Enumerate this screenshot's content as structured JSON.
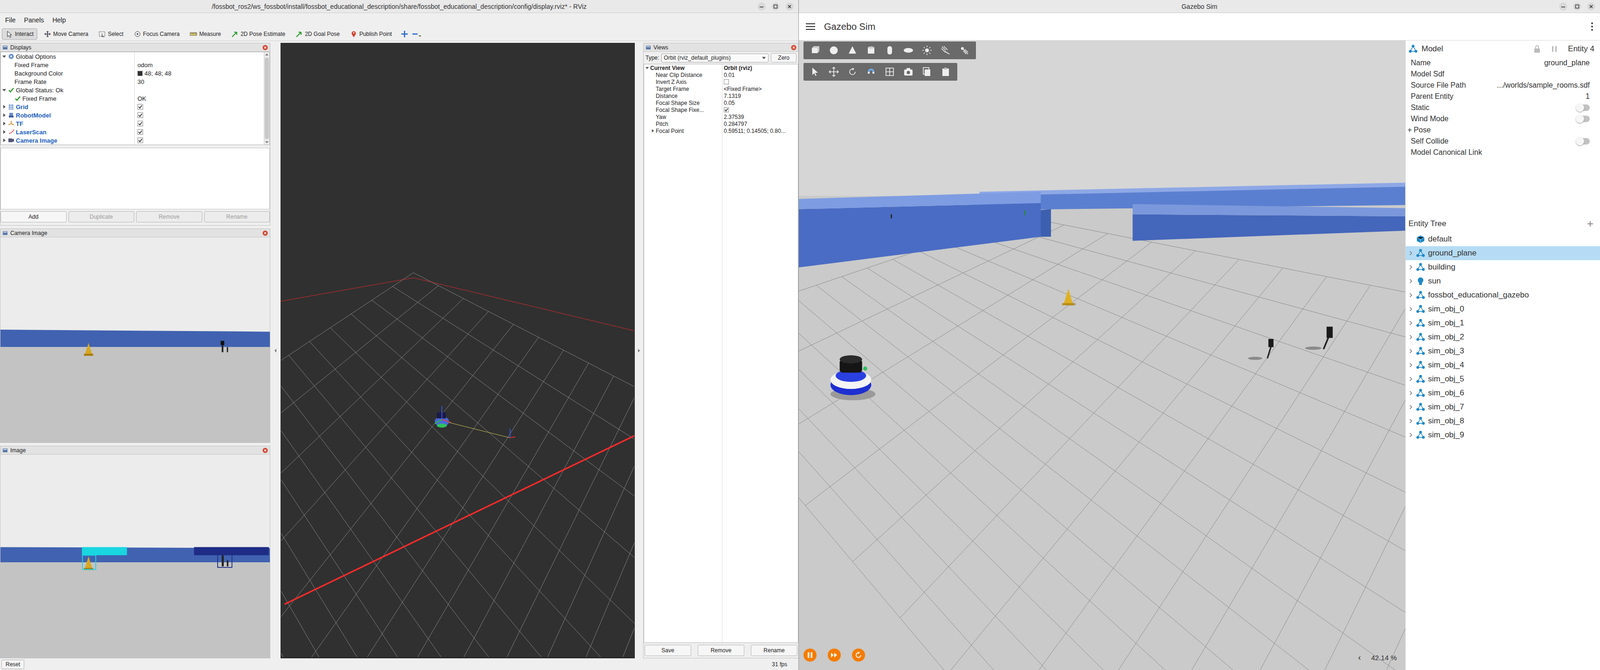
{
  "rviz": {
    "title": "/fossbot_ros2/ws_fossbot/install/fossbot_educational_description/share/fossbot_educational_description/config/display.rviz* - RViz",
    "menu": [
      "File",
      "Panels",
      "Help"
    ],
    "tools": [
      {
        "label": "Interact",
        "selected": true
      },
      {
        "label": "Move Camera",
        "selected": false
      },
      {
        "label": "Select",
        "selected": false
      },
      {
        "label": "Focus Camera",
        "selected": false
      },
      {
        "label": "Measure",
        "selected": false
      },
      {
        "label": "2D Pose Estimate",
        "selected": false
      },
      {
        "label": "2D Goal Pose",
        "selected": false
      },
      {
        "label": "Publish Point",
        "selected": false
      }
    ],
    "displays": {
      "title": "Displays",
      "rows": [
        {
          "label": "Global Options",
          "kind": "group",
          "depth": 0,
          "expanded": true
        },
        {
          "label": "Fixed Frame",
          "value": "odom",
          "kind": "property",
          "depth": 1
        },
        {
          "label": "Background Color",
          "value": "48; 48; 48",
          "kind": "color",
          "depth": 1,
          "color": "#303030"
        },
        {
          "label": "Frame Rate",
          "value": "30",
          "kind": "property",
          "depth": 1
        },
        {
          "label": "Global Status: Ok",
          "kind": "status",
          "depth": 0,
          "expanded": true
        },
        {
          "label": "Fixed Frame",
          "value": "OK",
          "kind": "status",
          "depth": 1
        },
        {
          "label": "Grid",
          "kind": "display",
          "depth": 0,
          "expanded": false,
          "checked": true
        },
        {
          "label": "RobotModel",
          "kind": "display",
          "depth": 0,
          "expanded": false,
          "checked": true
        },
        {
          "label": "TF",
          "kind": "display",
          "depth": 0,
          "expanded": false,
          "checked": true
        },
        {
          "label": "LaserScan",
          "kind": "display",
          "depth": 0,
          "expanded": false,
          "checked": true
        },
        {
          "label": "Camera Image",
          "kind": "display",
          "depth": 0,
          "expanded": false,
          "checked": true
        }
      ],
      "buttons": [
        {
          "label": "Add",
          "disabled": false
        },
        {
          "label": "Duplicate",
          "disabled": true
        },
        {
          "label": "Remove",
          "disabled": true
        },
        {
          "label": "Rename",
          "disabled": true
        }
      ]
    },
    "camera_panel": {
      "title": "Camera Image"
    },
    "image_panel": {
      "title": "Image"
    },
    "views": {
      "title": "Views",
      "type_label": "Type:",
      "type_value": "Orbit (rviz_default_plugins)",
      "zero": "Zero",
      "rows": [
        {
          "label": "Current View",
          "value": "Orbit (rviz)",
          "kind": "group",
          "depth": 0,
          "expanded": true
        },
        {
          "label": "Near Clip Distance",
          "value": "0.01",
          "kind": "text",
          "depth": 1
        },
        {
          "label": "Invert Z Axis",
          "kind": "check",
          "depth": 1,
          "checked": false
        },
        {
          "label": "Target Frame",
          "value": "<Fixed Frame>",
          "kind": "text",
          "depth": 1
        },
        {
          "label": "Distance",
          "value": "7.1319",
          "kind": "text",
          "depth": 1
        },
        {
          "label": "Focal Shape Size",
          "value": "0.05",
          "kind": "text",
          "depth": 1
        },
        {
          "label": "Focal Shape Fixe...",
          "kind": "check",
          "depth": 1,
          "checked": true
        },
        {
          "label": "Yaw",
          "value": "2.37539",
          "kind": "text",
          "depth": 1
        },
        {
          "label": "Pitch",
          "value": "0.284797",
          "kind": "text",
          "depth": 1
        },
        {
          "label": "Focal Point",
          "value": "0.59511; 0.14505; 0.80...",
          "kind": "group",
          "depth": 1,
          "expanded": false
        }
      ],
      "buttons": [
        "Save",
        "Remove",
        "Rename"
      ]
    },
    "status_bar": {
      "reset": "Reset",
      "fps": "31 fps"
    }
  },
  "gazebo": {
    "title": "Gazebo Sim",
    "app_title": "Gazebo Sim",
    "inspector": {
      "title": "Model",
      "entity": "Entity 4",
      "rows": [
        {
          "label": "Name",
          "value": "ground_plane",
          "kind": "text"
        },
        {
          "label": "Model Sdf",
          "kind": "label"
        },
        {
          "label": "Source File Path",
          "value": ".../worlds/sample_rooms.sdf",
          "kind": "text"
        },
        {
          "label": "Parent Entity",
          "value": "1",
          "kind": "text"
        },
        {
          "label": "Static",
          "kind": "toggle",
          "on": false
        },
        {
          "label": "Wind Mode",
          "kind": "toggle",
          "on": false
        },
        {
          "label": "Pose",
          "kind": "group",
          "expander": "+",
          "expanded": false
        },
        {
          "label": "Self Collide",
          "kind": "toggle",
          "on": false
        },
        {
          "label": "Model Canonical Link",
          "kind": "label"
        }
      ]
    },
    "entity_tree": {
      "title": "Entity Tree",
      "add": "+",
      "items": [
        {
          "label": "default",
          "kind": "world",
          "selected": false
        },
        {
          "label": "ground_plane",
          "kind": "model",
          "selected": true
        },
        {
          "label": "building",
          "kind": "model",
          "selected": false
        },
        {
          "label": "sun",
          "kind": "light",
          "selected": false
        },
        {
          "label": "fossbot_educational_gazebo",
          "kind": "model",
          "selected": false
        },
        {
          "label": "sim_obj_0",
          "kind": "model",
          "selected": false
        },
        {
          "label": "sim_obj_1",
          "kind": "model",
          "selected": false
        },
        {
          "label": "sim_obj_2",
          "kind": "model",
          "selected": false
        },
        {
          "label": "sim_obj_3",
          "kind": "model",
          "selected": false
        },
        {
          "label": "sim_obj_4",
          "kind": "model",
          "selected": false
        },
        {
          "label": "sim_obj_5",
          "kind": "model",
          "selected": false
        },
        {
          "label": "sim_obj_6",
          "kind": "model",
          "selected": false
        },
        {
          "label": "sim_obj_7",
          "kind": "model",
          "selected": false
        },
        {
          "label": "sim_obj_8",
          "kind": "model",
          "selected": false
        },
        {
          "label": "sim_obj_9",
          "kind": "model",
          "selected": false
        }
      ]
    },
    "playback": {
      "running": true
    },
    "zoom": {
      "collapse": "‹",
      "value": "42.14 %"
    }
  }
}
